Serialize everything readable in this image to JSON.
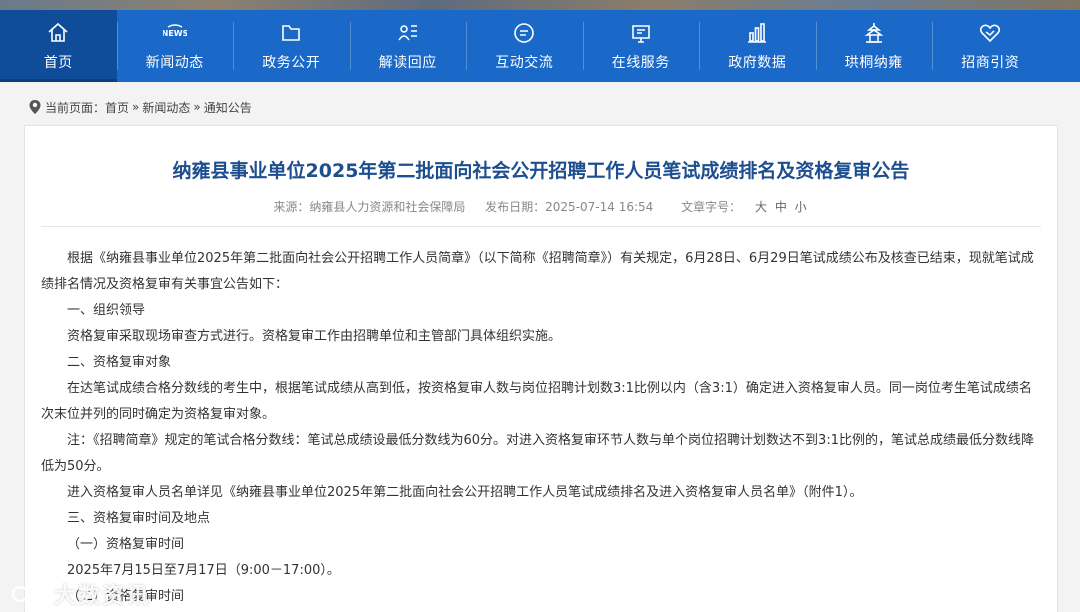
{
  "nav": {
    "items": [
      {
        "label": "首页",
        "icon": "home-icon"
      },
      {
        "label": "新闻动态",
        "icon": "news-icon"
      },
      {
        "label": "政务公开",
        "icon": "folder-icon"
      },
      {
        "label": "解读回应",
        "icon": "interpret-icon"
      },
      {
        "label": "互动交流",
        "icon": "chat-icon"
      },
      {
        "label": "在线服务",
        "icon": "service-icon"
      },
      {
        "label": "政府数据",
        "icon": "chart-icon"
      },
      {
        "label": "珙桐纳雍",
        "icon": "tower-icon"
      },
      {
        "label": "招商引资",
        "icon": "handshake-icon"
      }
    ],
    "active_index": 0,
    "colors": {
      "bar": "#1a68c7",
      "active": "#0f4d9a"
    }
  },
  "breadcrumb": {
    "prefix": "当前页面：",
    "items": [
      "首页",
      "新闻动态",
      "通知公告"
    ],
    "separator": "»"
  },
  "article": {
    "title": "纳雍县事业单位2025年第二批面向社会公开招聘工作人员笔试成绩排名及资格复审公告",
    "source": "来源：纳雍县人力资源和社会保障局",
    "date": "发布日期：2025-07-14 16:54",
    "font_size_label": "文章字号：",
    "font_sizes": [
      "大",
      "中",
      "小"
    ],
    "paragraphs": [
      "根据《纳雍县事业单位2025年第二批面向社会公开招聘工作人员简章》（以下简称《招聘简章》）有关规定，6月28日、6月29日笔试成绩公布及核查已结束，现就笔试成绩排名情况及资格复审有关事宜公告如下：",
      "一、组织领导",
      "资格复审采取现场审查方式进行。资格复审工作由招聘单位和主管部门具体组织实施。",
      "二、资格复审对象",
      "在达笔试成绩合格分数线的考生中，根据笔试成绩从高到低，按资格复审人数与岗位招聘计划数3:1比例以内（含3:1）确定进入资格复审人员。同一岗位考生笔试成绩名次末位并列的同时确定为资格复审对象。",
      "注：《招聘简章》规定的笔试合格分数线：笔试总成绩设最低分数线为60分。对进入资格复审环节人数与单个岗位招聘计划数达不到3:1比例的，笔试总成绩最低分数线降低为50分。",
      "进入资格复审人员名单详见《纳雍县事业单位2025年第二批面向社会公开招聘工作人员笔试成绩排名及进入资格复审人员名单》（附件1）。",
      "三、资格复审时间及地点",
      "（一）资格复审时间",
      "2025年7月15日至7月17日（9:00－17:00）。",
      "（二）资格复审时间"
    ],
    "title_color": "#1d4e8f"
  },
  "watermark": {
    "text": "大数资讯"
  }
}
